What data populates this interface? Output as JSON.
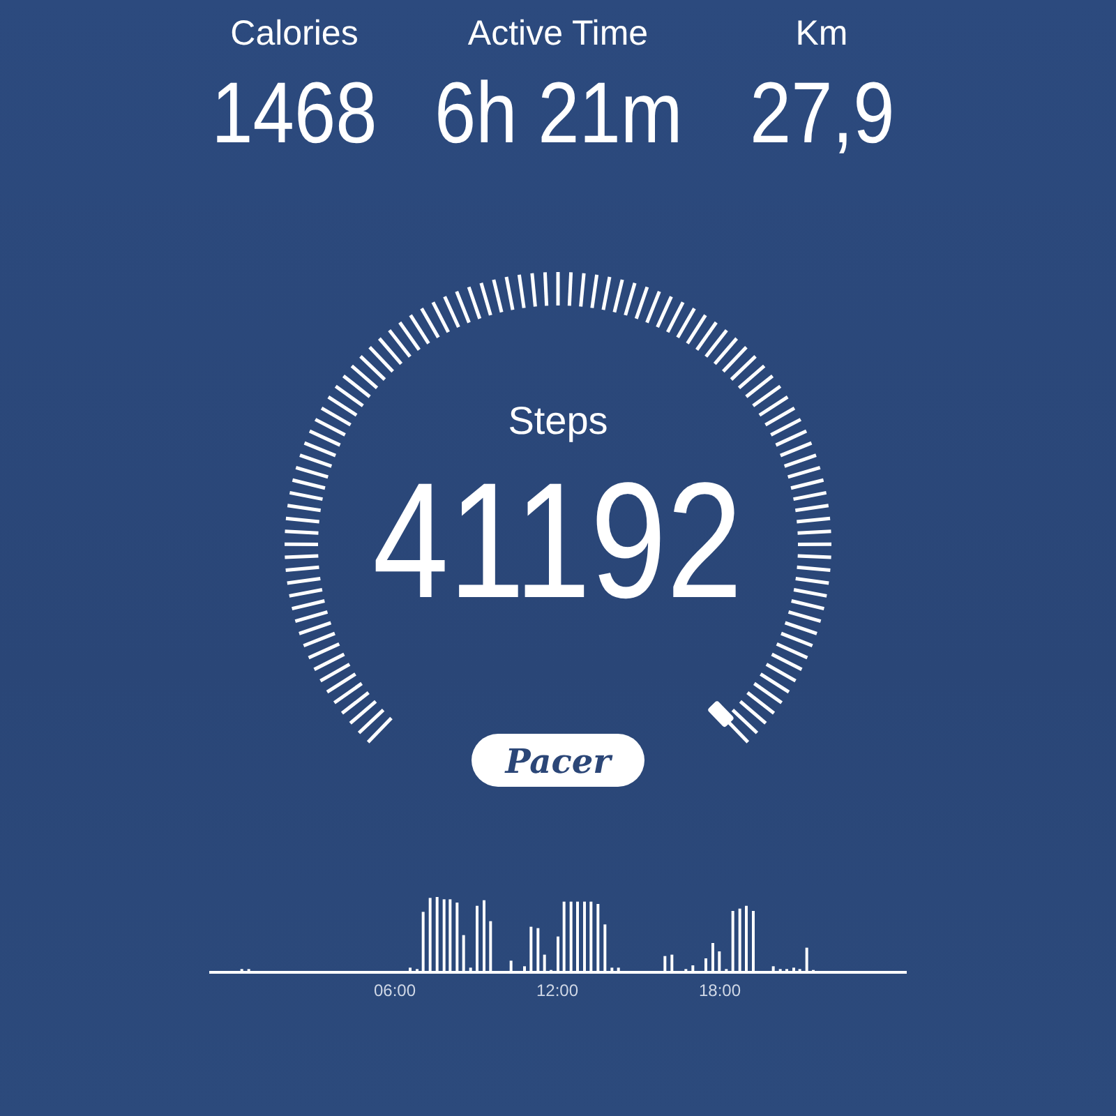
{
  "stats": [
    {
      "label": "Calories",
      "value": "1468"
    },
    {
      "label": "Active Time",
      "value": "6h 21m"
    },
    {
      "label": "Km",
      "value": "27,9"
    }
  ],
  "steps": {
    "label": "Steps",
    "value": "41192"
  },
  "brand": "Pacer",
  "activity": {
    "hour_labels": [
      "06:00",
      "12:00",
      "18:00"
    ]
  }
}
